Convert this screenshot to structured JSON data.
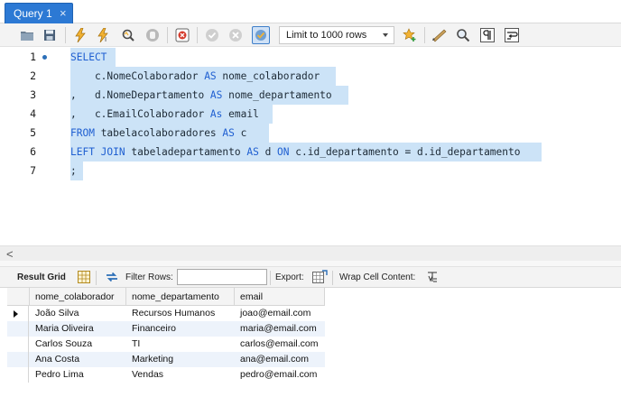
{
  "tab": {
    "label": "Query 1",
    "close_glyph": "×"
  },
  "toolbar": {
    "limit_label": "Limit to 1000 rows",
    "icons": [
      "open-folder-icon",
      "save-icon",
      "execute-icon",
      "execute-current-icon",
      "explain-icon",
      "stop-icon",
      "toggle-error-icon",
      "commit-icon",
      "rollback-icon",
      "autocommit-icon",
      "bookmark-star-icon",
      "beautify-icon",
      "find-icon",
      "invisible-chars-icon",
      "wrap-icon"
    ]
  },
  "editor": {
    "lines": [
      {
        "n": "1",
        "tokens": [
          {
            "t": "SELECT",
            "k": true
          }
        ]
      },
      {
        "n": "2",
        "tokens": [
          {
            "t": "    c.NomeColaborador ",
            "k": false
          },
          {
            "t": "AS",
            "k": true
          },
          {
            "t": " nome_colaborador",
            "k": false
          }
        ]
      },
      {
        "n": "3",
        "tokens": [
          {
            "t": ",   d.NomeDepartamento ",
            "k": false
          },
          {
            "t": "AS",
            "k": true
          },
          {
            "t": " nome_departamento",
            "k": false
          }
        ]
      },
      {
        "n": "4",
        "tokens": [
          {
            "t": ",   c.EmailColaborador ",
            "k": false
          },
          {
            "t": "As",
            "k": true
          },
          {
            "t": " email",
            "k": false
          }
        ]
      },
      {
        "n": "5",
        "tokens": [
          {
            "t": "FROM",
            "k": true
          },
          {
            "t": " tabelacolaboradores ",
            "k": false
          },
          {
            "t": "AS",
            "k": true
          },
          {
            "t": " c",
            "k": false
          }
        ]
      },
      {
        "n": "6",
        "tokens": [
          {
            "t": "LEFT JOIN",
            "k": true
          },
          {
            "t": " tabeladepartamento ",
            "k": false
          },
          {
            "t": "AS",
            "k": true
          },
          {
            "t": " d ",
            "k": false
          },
          {
            "t": "ON",
            "k": true
          },
          {
            "t": " c.id_departamento = d.id_departamento",
            "k": false
          }
        ]
      },
      {
        "n": "7",
        "tokens": [
          {
            "t": ";",
            "k": false
          }
        ]
      }
    ]
  },
  "scroll": {
    "left_arrow": "<"
  },
  "results": {
    "result_grid_label": "Result Grid",
    "filter_rows_label": "Filter Rows:",
    "filter_value": "",
    "export_label": "Export:",
    "wrap_label": "Wrap Cell Content:",
    "columns": [
      "nome_colaborador",
      "nome_departamento",
      "email"
    ],
    "rows": [
      [
        "João Silva",
        "Recursos Humanos",
        "joao@email.com"
      ],
      [
        "Maria Oliveira",
        "Financeiro",
        "maria@email.com"
      ],
      [
        "Carlos Souza",
        "TI",
        "carlos@email.com"
      ],
      [
        "Ana Costa",
        "Marketing",
        "ana@email.com"
      ],
      [
        "Pedro Lima",
        "Vendas",
        "pedro@email.com"
      ]
    ]
  }
}
